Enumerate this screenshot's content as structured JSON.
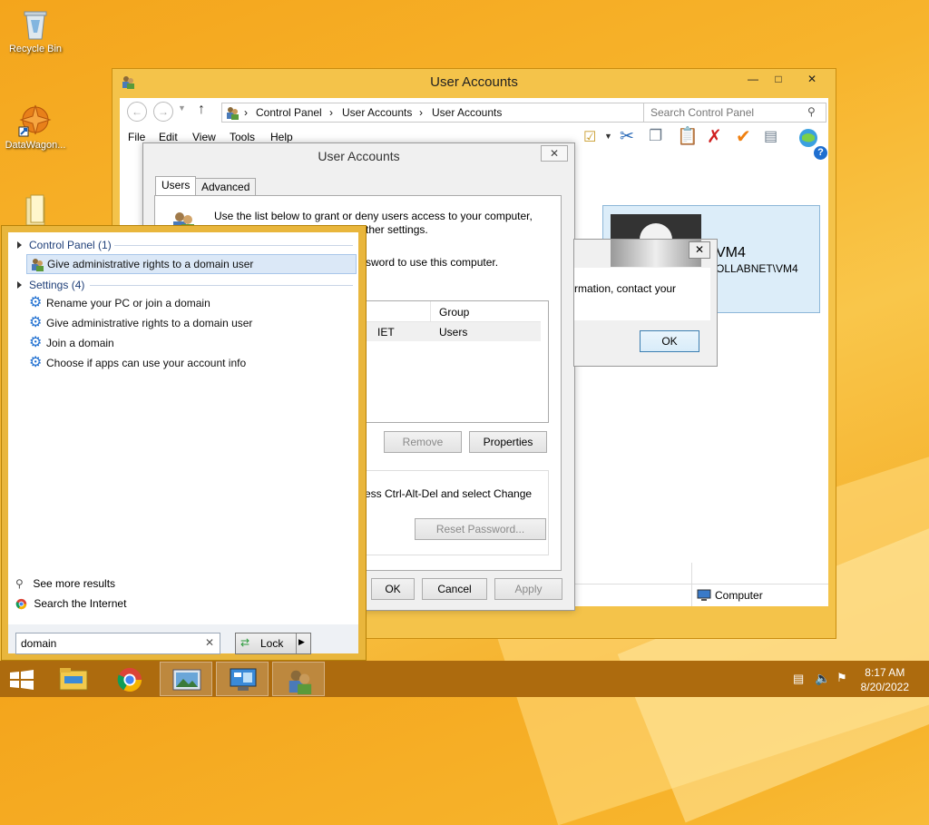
{
  "desktop": {
    "icons": [
      {
        "label": "Recycle Bin",
        "icon": "recycle-bin-icon"
      },
      {
        "label": "DataWagon...",
        "icon": "datawagon-icon"
      },
      {
        "label": "",
        "icon": "folder-icon"
      }
    ]
  },
  "explorer": {
    "title": "User Accounts",
    "breadcrumb": [
      "Control Panel",
      "User Accounts",
      "User Accounts"
    ],
    "search_placeholder": "Search Control Panel",
    "menu": [
      "File",
      "Edit",
      "View",
      "Tools",
      "Help"
    ],
    "user_card": {
      "name": "VM4",
      "domain": "OLLABNET\\VM4"
    },
    "status": "Computer"
  },
  "ua_dialog": {
    "title": "User Accounts",
    "tabs": [
      "Users",
      "Advanced"
    ],
    "intro_line1": "Use the list below to grant or deny users access to your computer,",
    "intro_line2": "ther settings.",
    "password_line": "sword to use this computer.",
    "table": {
      "columns": [
        "",
        "Group"
      ],
      "rows": [
        {
          "user": "IET",
          "group": "Users"
        }
      ]
    },
    "remove_label": "Remove",
    "properties_label": "Properties",
    "password_note": "ess Ctrl-Alt-Del and select Change",
    "reset_password_label": "Reset Password...",
    "ok_label": "OK",
    "cancel_label": "Cancel",
    "apply_label": "Apply"
  },
  "msg_dialog": {
    "text": "rmation, contact your",
    "ok_label": "OK"
  },
  "search": {
    "groups": [
      {
        "label": "Control Panel (1)",
        "items": [
          "Give administrative rights to a domain user"
        ]
      },
      {
        "label": "Settings (4)",
        "items": [
          "Rename your PC or join a domain",
          "Give administrative rights to a domain user",
          "Join a domain",
          "Choose if apps can use your account info"
        ]
      }
    ],
    "see_more": "See more results",
    "search_internet": "Search the Internet",
    "query": "domain",
    "lock_label": "Lock"
  },
  "taskbar": {
    "apps": [
      "file-explorer-icon",
      "chrome-icon",
      "photo-viewer-icon",
      "control-panel-icon",
      "user-accounts-icon"
    ],
    "time": "8:17 AM",
    "date": "8/20/2022"
  },
  "colors": {
    "accent": "#f4c34a",
    "taskbar": "#ad6b0e",
    "link": "#1f3f78",
    "selection": "#dbe8f7"
  }
}
